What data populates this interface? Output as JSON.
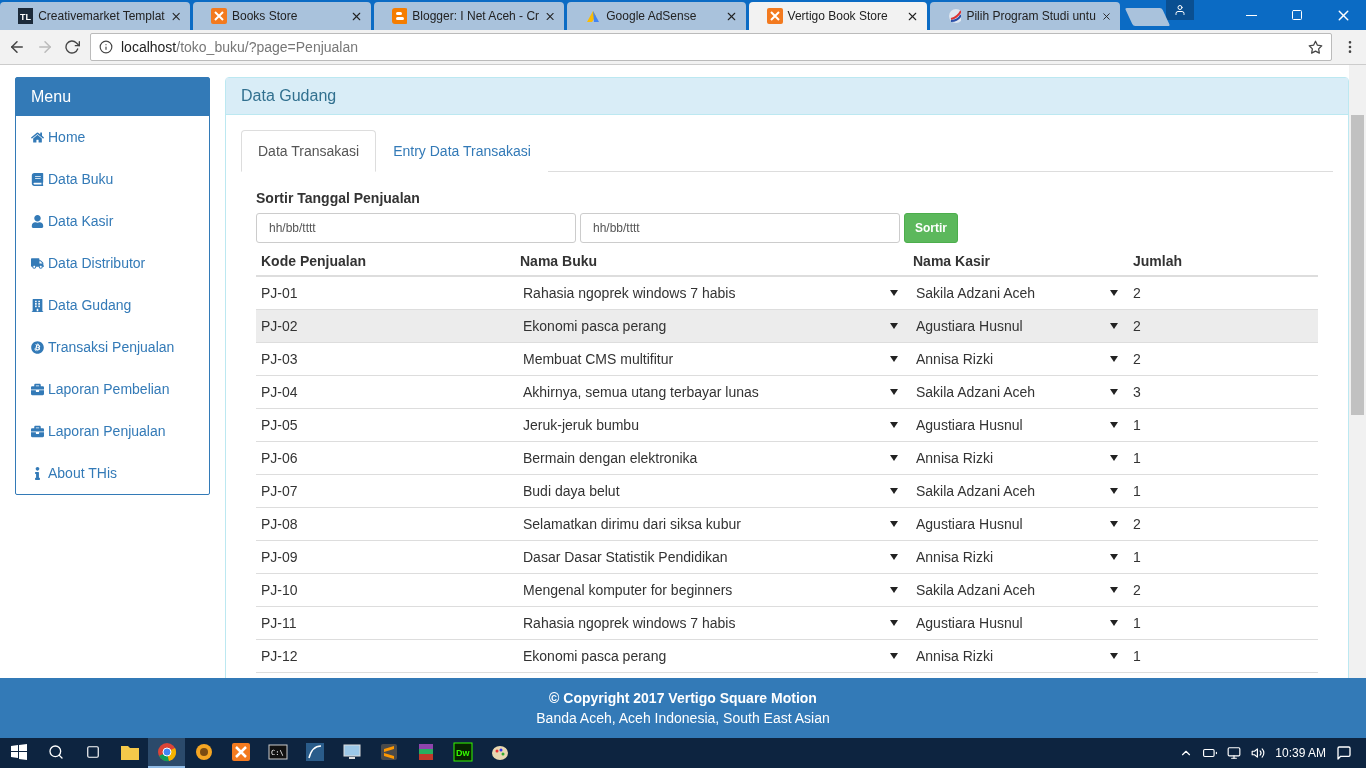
{
  "browser": {
    "tabs": [
      {
        "title": "Creativemarket Templat",
        "logo_text": "TL",
        "selected": false
      },
      {
        "title": "Books Store",
        "selected": false
      },
      {
        "title": "Blogger: I Net Aceh - Cr",
        "selected": false
      },
      {
        "title": "Google AdSense",
        "selected": false
      },
      {
        "title": "Vertigo Book Store",
        "selected": true
      },
      {
        "title": "Pilih Program Studi untu",
        "selected": false
      }
    ],
    "url_host": "localhost",
    "url_path": "/toko_buku/?page=Penjualan"
  },
  "sidebar": {
    "title": "Menu",
    "items": [
      {
        "label": "Home"
      },
      {
        "label": "Data Buku"
      },
      {
        "label": "Data Kasir"
      },
      {
        "label": "Data Distributor"
      },
      {
        "label": "Data Gudang"
      },
      {
        "label": "Transaksi Penjualan"
      },
      {
        "label": "Laporan Pembelian"
      },
      {
        "label": "Laporan Penjualan"
      },
      {
        "label": "About THis"
      }
    ]
  },
  "panel": {
    "title": "Data Gudang",
    "tabs": [
      {
        "label": "Data Transakasi",
        "selected": true
      },
      {
        "label": "Entry Data Transakasi",
        "selected": false
      }
    ],
    "filter": {
      "label": "Sortir Tanggal Penjualan",
      "from_placeholder": "hh/bb/tttt",
      "to_placeholder": "hh/bb/tttt",
      "button": "Sortir"
    },
    "table": {
      "columns": [
        "Kode Penjualan",
        "Nama Buku",
        "Nama Kasir",
        "Jumlah"
      ],
      "rows": [
        {
          "kode": "PJ-01",
          "buku": "Rahasia ngoprek windows 7 habis",
          "kasir": "Sakila Adzani Aceh",
          "jumlah": "2",
          "selected": false
        },
        {
          "kode": "PJ-02",
          "buku": "Ekonomi pasca perang",
          "kasir": "Agustiara Husnul",
          "jumlah": "2",
          "selected": true
        },
        {
          "kode": "PJ-03",
          "buku": "Membuat CMS multifitur",
          "kasir": "Annisa Rizki",
          "jumlah": "2",
          "selected": false
        },
        {
          "kode": "PJ-04",
          "buku": "Akhirnya, semua utang terbayar lunas",
          "kasir": "Sakila Adzani Aceh",
          "jumlah": "3",
          "selected": false
        },
        {
          "kode": "PJ-05",
          "buku": "Jeruk-jeruk bumbu",
          "kasir": "Agustiara Husnul",
          "jumlah": "1",
          "selected": false
        },
        {
          "kode": "PJ-06",
          "buku": "Bermain dengan elektronika",
          "kasir": "Annisa Rizki",
          "jumlah": "1",
          "selected": false
        },
        {
          "kode": "PJ-07",
          "buku": "Budi daya belut",
          "kasir": "Sakila Adzani Aceh",
          "jumlah": "1",
          "selected": false
        },
        {
          "kode": "PJ-08",
          "buku": "Selamatkan dirimu dari siksa kubur",
          "kasir": "Agustiara Husnul",
          "jumlah": "2",
          "selected": false
        },
        {
          "kode": "PJ-09",
          "buku": "Dasar Dasar Statistik Pendidikan",
          "kasir": "Annisa Rizki",
          "jumlah": "1",
          "selected": false
        },
        {
          "kode": "PJ-10",
          "buku": "Mengenal komputer for beginners",
          "kasir": "Sakila Adzani Aceh",
          "jumlah": "2",
          "selected": false
        },
        {
          "kode": "PJ-11",
          "buku": "Rahasia ngoprek windows 7 habis",
          "kasir": "Agustiara Husnul",
          "jumlah": "1",
          "selected": false
        },
        {
          "kode": "PJ-12",
          "buku": "Ekonomi pasca perang",
          "kasir": "Annisa Rizki",
          "jumlah": "1",
          "selected": false
        }
      ]
    }
  },
  "footer": {
    "copyright": "© Copyright 2017 Vertigo Square Motion",
    "address": "Banda Aceh, Aceh Indonesia, South East Asian"
  },
  "taskbar": {
    "apps": [
      {
        "kind": "explorer",
        "active": false
      },
      {
        "kind": "chrome",
        "active": true
      },
      {
        "kind": "sunflower",
        "active": false
      },
      {
        "kind": "xampp",
        "active": false
      },
      {
        "kind": "cmd",
        "text": "C:\\",
        "active": false
      },
      {
        "kind": "mysql",
        "active": false
      },
      {
        "kind": "monitor",
        "active": false
      },
      {
        "kind": "sublime",
        "active": false
      },
      {
        "kind": "winrar",
        "active": false
      },
      {
        "kind": "dreamweaver",
        "text": "Dw",
        "active": false
      },
      {
        "kind": "paint",
        "active": false
      }
    ],
    "time": "10:39 AM"
  }
}
